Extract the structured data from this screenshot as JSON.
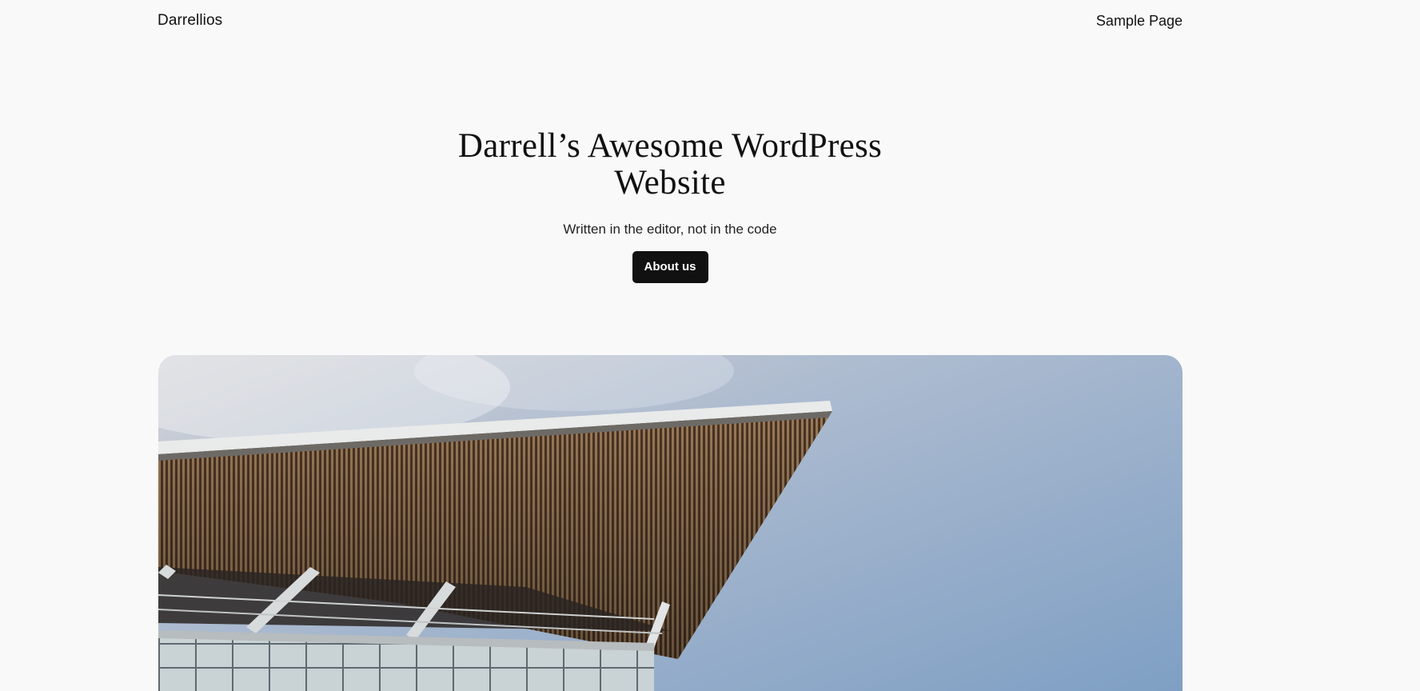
{
  "header": {
    "site_title": "Darrellios",
    "nav": [
      {
        "label": "Sample Page"
      }
    ]
  },
  "hero": {
    "title": "Darrell’s Awesome WordPress Website",
    "subtitle": "Written in the editor, not in the code",
    "button_label": "About us"
  },
  "image": {
    "subject": "building-roof-against-sky",
    "colors": {
      "sky_top": "#c9ccd2",
      "sky_mid": "#9fb3cc",
      "sky_right": "#7d9ec4",
      "slats": "#8a6a4a",
      "slats_dark": "#3a2a20",
      "roof_edge": "#e8e8e8",
      "glass": "#cfd6d8"
    }
  }
}
